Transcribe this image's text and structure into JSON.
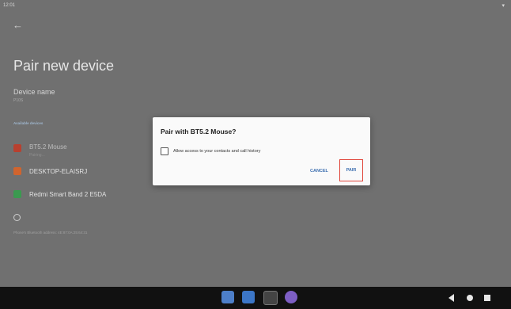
{
  "status": {
    "time": "12:01",
    "wifi_icon": "wifi-icon"
  },
  "page": {
    "title": "Pair new device",
    "device_name_label": "Device name",
    "device_name_value": "P10S",
    "available_devices_label": "Available devices",
    "devices": [
      {
        "name": "BT5.2 Mouse",
        "sub": "Pairing...",
        "icon": "mouse-icon",
        "color": "#b8402f"
      },
      {
        "name": "DESKTOP-ELAISRJ",
        "sub": "",
        "icon": "computer-icon",
        "color": "#d0642e"
      },
      {
        "name": "Redmi Smart Band 2 E5DA",
        "sub": "",
        "icon": "band-icon",
        "color": "#3b9a50"
      }
    ],
    "bluetooth_address": "Phone's Bluetooth address: 4E:87:0A:25:64:31"
  },
  "dialog": {
    "title": "Pair with BT5.2 Mouse?",
    "checkbox_label": "Allow access to your contacts and call history",
    "cancel_label": "CANCEL",
    "pair_label": "PAIR"
  },
  "navbar": {
    "apps": [
      {
        "name": "files-app-icon",
        "color": "#4d7fc9"
      },
      {
        "name": "gallery-app-icon",
        "color": "#3c76c7"
      },
      {
        "name": "camera-app-icon",
        "color": "#444444"
      },
      {
        "name": "apps-grid-icon",
        "color": "#7d5ec4"
      }
    ]
  }
}
